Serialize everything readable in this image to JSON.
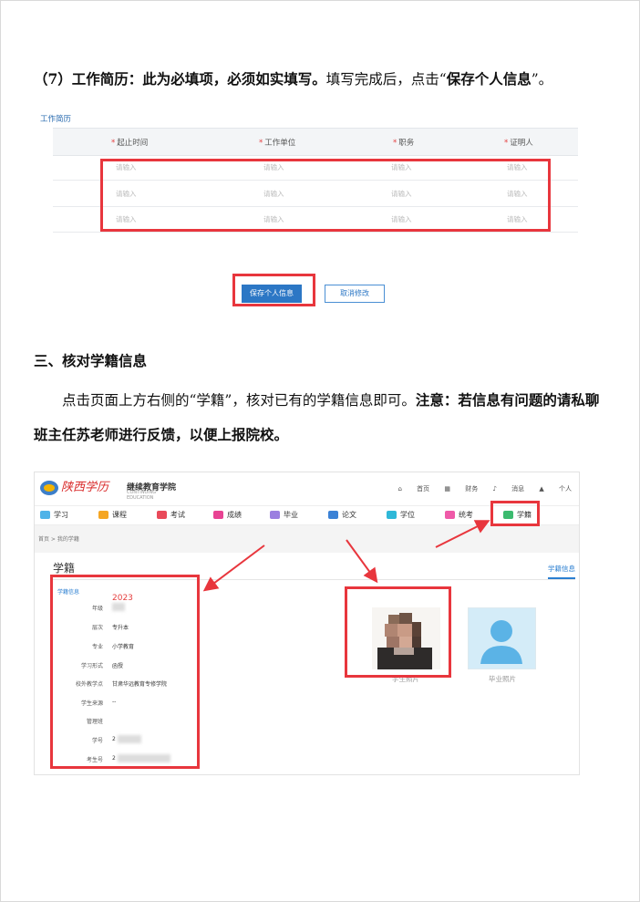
{
  "section7": {
    "lead": "（7）工作简历：此为必填项，必须如实填写。",
    "tail_a": "填写完成后，点击“",
    "tail_bold": "保存个人信息",
    "tail_b": "”。"
  },
  "work_history": {
    "title": "工作简历",
    "columns": [
      "起止时间",
      "工作单位",
      "职务",
      "证明人"
    ],
    "placeholder": "请输入",
    "save_label": "保存个人信息",
    "cancel_label": "取消修改"
  },
  "section3": {
    "heading": "三、核对学籍信息",
    "para_a": "点击页面上方右侧的“学籍”，核对已有的学籍信息即可。",
    "para_bold": "注意：若信息有问题的请私聊班主任苏老师进行反馈，以便上报院校。"
  },
  "portal": {
    "logo_text": "陕西学历",
    "school_name": "继续教育学院",
    "school_sub": "CONTINUING EDUCATION",
    "top_links": [
      "首页",
      "财务",
      "消息",
      "个人"
    ],
    "nav": [
      {
        "label": "学习",
        "color": "#4fb3e8"
      },
      {
        "label": "课程",
        "color": "#f5a623"
      },
      {
        "label": "考试",
        "color": "#e94a5a"
      },
      {
        "label": "成绩",
        "color": "#e84393"
      },
      {
        "label": "毕业",
        "color": "#9b7fe0"
      },
      {
        "label": "论文",
        "color": "#3b82d6"
      },
      {
        "label": "学位",
        "color": "#2fb8d8"
      },
      {
        "label": "统考",
        "color": "#ef5aa8"
      },
      {
        "label": "学籍",
        "color": "#3cba6f"
      }
    ],
    "breadcrumb": "首页 > 我的学籍",
    "page_title": "学籍",
    "tab": "学籍信息",
    "section_label": "学籍信息",
    "year_note": "2023",
    "fields": [
      {
        "label": "年级",
        "value": ""
      },
      {
        "label": "层次",
        "value": "专升本"
      },
      {
        "label": "专业",
        "value": "小学教育"
      },
      {
        "label": "学习形式",
        "value": "函授"
      },
      {
        "label": "校外教学点",
        "value": "甘肃华远教育专修学院"
      },
      {
        "label": "学生来源",
        "value": "--"
      },
      {
        "label": "管理班",
        "value": ""
      },
      {
        "label": "学号",
        "value": "2"
      },
      {
        "label": "考生号",
        "value": "2"
      }
    ],
    "student_photo_caption": "学生照片",
    "grad_photo_caption": "毕业照片"
  }
}
